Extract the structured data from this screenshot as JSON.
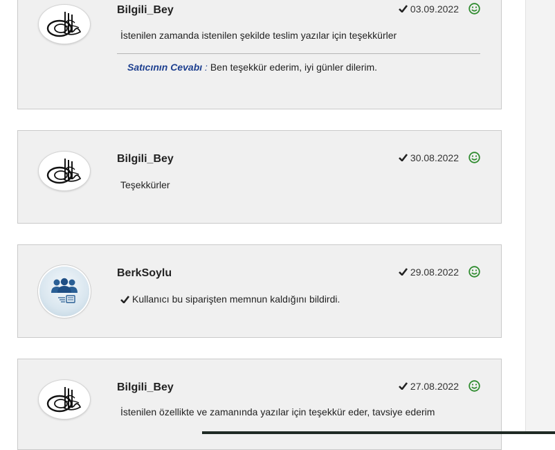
{
  "reviews": [
    {
      "username": "Bilgili_Bey",
      "date": "03.09.2022",
      "comment": "İstenilen zamanda istenilen şekilde teslim yazılar için teşekkürler",
      "reply": {
        "label": "Satıcının Cevabı",
        "sep": " : ",
        "text": "Ben teşekkür ederim, iyi günler dilerim."
      }
    },
    {
      "username": "Bilgili_Bey",
      "date": "30.08.2022",
      "comment": "Teşekkürler"
    },
    {
      "username": "BerkSoylu",
      "date": "29.08.2022",
      "comment": "Kullanıcı bu siparişten memnun kaldığını bildirdi."
    },
    {
      "username": "Bilgili_Bey",
      "date": "27.08.2022",
      "comment": "İstenilen özellikte ve zamanında yazılar için teşekkür eder, tavsiye ederim"
    }
  ],
  "icons": {
    "check": "checkmark-icon",
    "rating": "smiley-icon",
    "avatar_tughra": "tughra-calligraphy-icon",
    "avatar_default": "users-group-icon"
  },
  "colors": {
    "card_bg": "#f0f0f0",
    "card_border": "#c9c9c9",
    "reply_label": "#1d3f8f",
    "positive": "#2e8b2e"
  }
}
